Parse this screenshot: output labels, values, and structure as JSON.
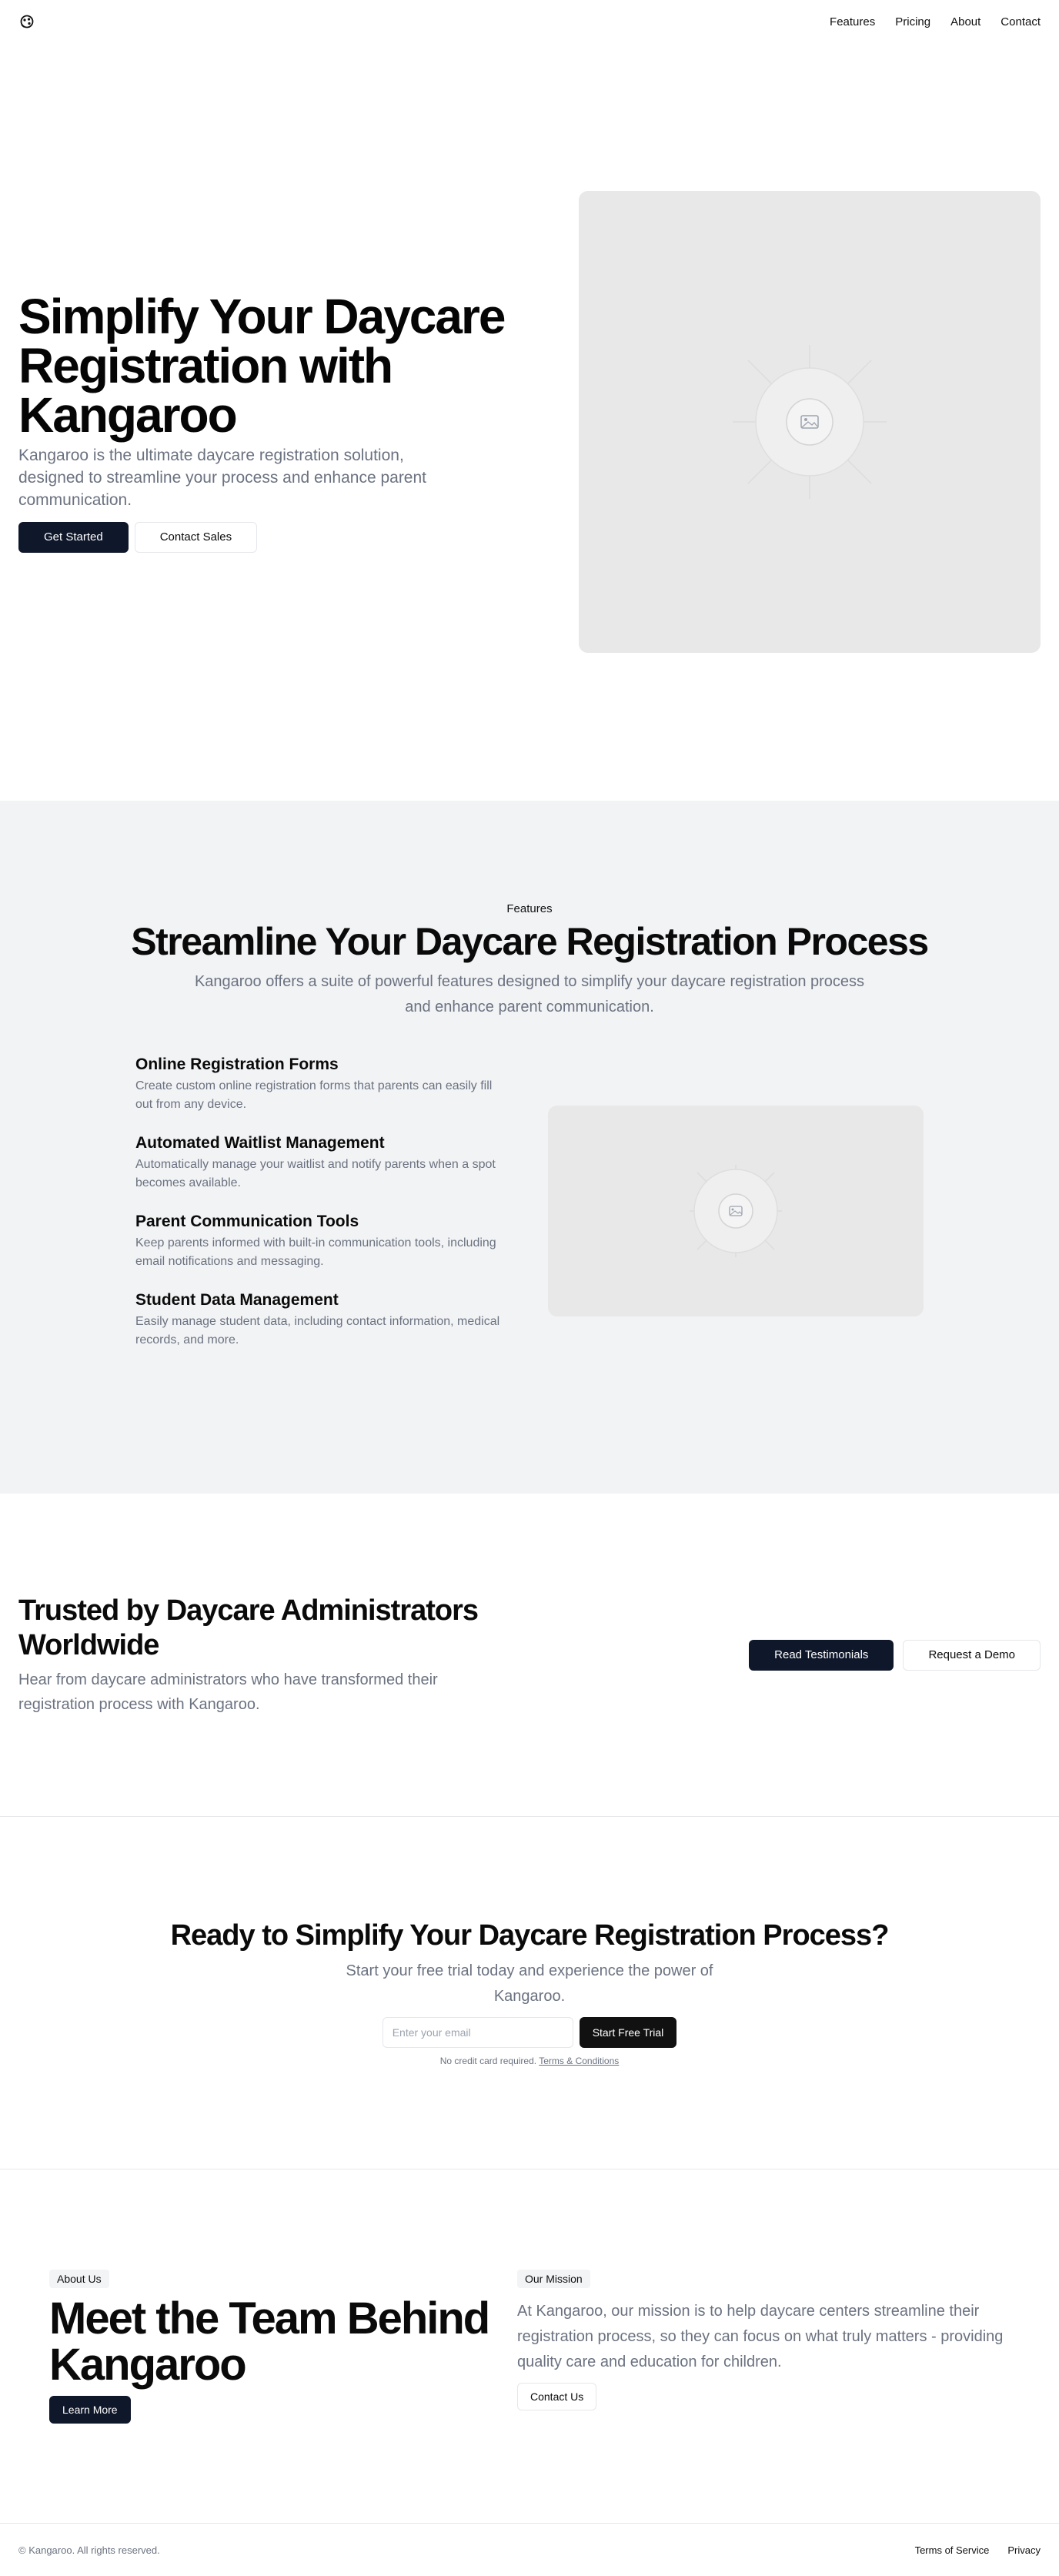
{
  "header": {
    "nav": [
      "Features",
      "Pricing",
      "About",
      "Contact"
    ]
  },
  "hero": {
    "title": "Simplify Your Daycare Registration with Kangaroo",
    "subtitle": "Kangaroo is the ultimate daycare registration solution, designed to streamline your process and enhance parent communication.",
    "primary_button": "Get Started",
    "secondary_button": "Contact Sales"
  },
  "features": {
    "eyebrow": "Features",
    "title": "Streamline Your Daycare Registration Process",
    "lead": "Kangaroo offers a suite of powerful features designed to simplify your daycare registration process and enhance parent communication.",
    "items": [
      {
        "title": "Online Registration Forms",
        "desc": "Create custom online registration forms that parents can easily fill out from any device."
      },
      {
        "title": "Automated Waitlist Management",
        "desc": "Automatically manage your waitlist and notify parents when a spot becomes available."
      },
      {
        "title": "Parent Communication Tools",
        "desc": "Keep parents informed with built-in communication tools, including email notifications and messaging."
      },
      {
        "title": "Student Data Management",
        "desc": "Easily manage student data, including contact information, medical records, and more."
      }
    ]
  },
  "testimonials": {
    "title": "Trusted by Daycare Administrators Worldwide",
    "subtitle": "Hear from daycare administrators who have transformed their registration process with Kangaroo.",
    "primary_button": "Read Testimonials",
    "secondary_button": "Request a Demo"
  },
  "cta": {
    "title": "Ready to Simplify Your Daycare Registration Process?",
    "subtitle": "Start your free trial today and experience the power of Kangaroo.",
    "email_placeholder": "Enter your email",
    "button": "Start Free Trial",
    "note": "No credit card required.",
    "terms_link": "Terms & Conditions"
  },
  "about": {
    "tag": "About Us",
    "title": "Meet the Team Behind Kangaroo",
    "button": "Learn More",
    "mission_tag": "Our Mission",
    "mission_text": "At Kangaroo, our mission is to help daycare centers streamline their registration process, so they can focus on what truly matters - providing quality care and education for children.",
    "mission_button": "Contact Us"
  },
  "footer": {
    "copyright": "© Kangaroo. All rights reserved.",
    "links": [
      "Terms of Service",
      "Privacy"
    ]
  },
  "icons": {
    "logo": "kangaroo-logo-icon",
    "placeholder": "image-placeholder-icon"
  },
  "colors": {
    "primary_button": "#0f172a",
    "section_bg": "#f2f3f5",
    "muted_text": "#6b7280",
    "placeholder_bg": "#e8e8e8"
  }
}
